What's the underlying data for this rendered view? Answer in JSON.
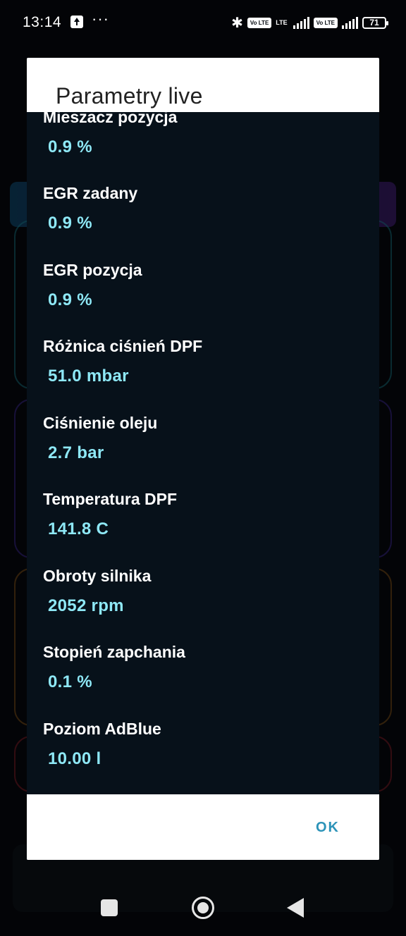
{
  "status_bar": {
    "time": "13:14",
    "overflow": "···",
    "network_1": "LTE",
    "volte_1": "Vo LTE",
    "volte_2": "Vo LTE",
    "battery": "71"
  },
  "dialog": {
    "title": "Parametry live",
    "items": [
      {
        "label": "Mieszacz pozycja",
        "value": "0.9 %"
      },
      {
        "label": "EGR zadany",
        "value": "0.9 %"
      },
      {
        "label": "EGR pozycja",
        "value": "0.9 %"
      },
      {
        "label": "Różnica ciśnień DPF",
        "value": "51.0 mbar"
      },
      {
        "label": "Ciśnienie oleju",
        "value": "2.7 bar"
      },
      {
        "label": "Temperatura DPF",
        "value": "141.8 C"
      },
      {
        "label": "Obroty silnika",
        "value": "2052 rpm"
      },
      {
        "label": "Stopień zapchania",
        "value": "0.1 %"
      },
      {
        "label": "Poziom AdBlue",
        "value": "10.00 l"
      }
    ],
    "ok_label": "OK"
  },
  "colors": {
    "list_background": "#07111a",
    "value_color": "#8ee8f6",
    "ok_color": "#2c93b8"
  }
}
